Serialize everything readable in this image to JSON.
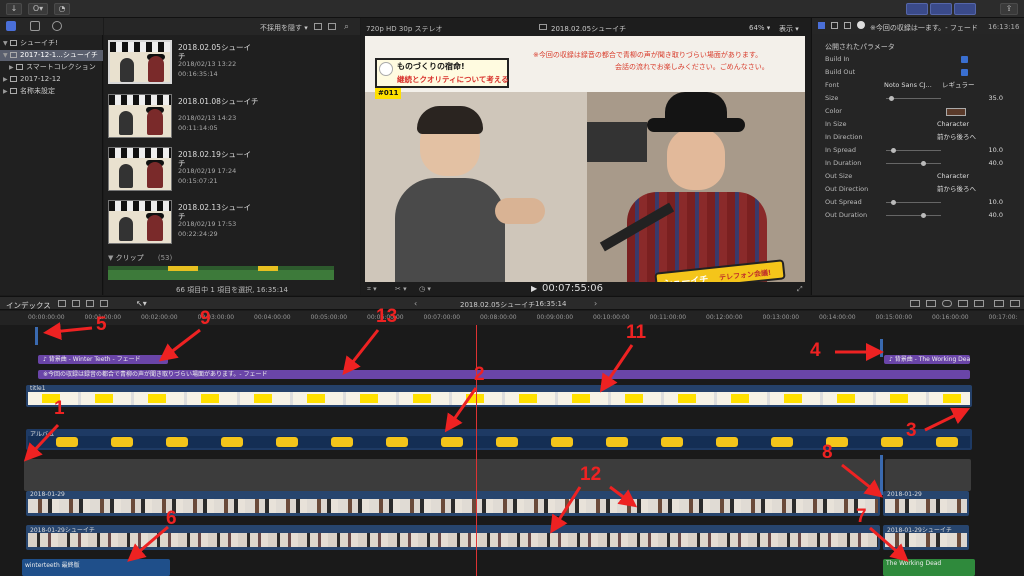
{
  "toolbar": {
    "import_glyph": "↓",
    "keyword_glyph": "O▾",
    "bg_task_glyph": "◔",
    "share_glyph": "⇪"
  },
  "library": {
    "items": [
      {
        "label": "シューイチ!",
        "expanded": true,
        "selected": false
      },
      {
        "label": "2017-12-1...シューイチ",
        "expanded": true,
        "selected": true
      },
      {
        "label": "スマートコレクション",
        "expanded": false,
        "selected": false
      },
      {
        "label": "2017-12-12",
        "expanded": false,
        "selected": false
      },
      {
        "label": "名称未設定",
        "expanded": false,
        "selected": false
      }
    ]
  },
  "browser": {
    "filter_label": "不採用を隠す ▾",
    "clips": [
      {
        "title": "2018.02.05シューイ",
        "title2": "チ",
        "date": "2018/02/13 13:22",
        "duration": "00:16:35:14"
      },
      {
        "title": "2018.01.08シューイチ",
        "title2": "",
        "date": "2018/02/13 14:23",
        "duration": "00:11:14:05"
      },
      {
        "title": "2018.02.19シューイ",
        "title2": "チ",
        "date": "2018/02/19 17:24",
        "duration": "00:15:07:21"
      },
      {
        "title": "2018.02.13シューイ",
        "title2": "チ",
        "date": "2018/02/19 17:53",
        "duration": "00:22:24:29"
      }
    ],
    "clips_section": "クリップ",
    "clips_count": "(53)",
    "status": "66 項目中 1 項目を選択, 16:35:14"
  },
  "viewer": {
    "format": "720p HD 30p ステレオ",
    "title": "2018.02.05シューイチ",
    "zoom": "64% ▾",
    "view": "表示 ▾",
    "timecode": "00:07:55:06",
    "overlay_title_line1": "ものづくりの宿命!",
    "overlay_title_line2": "継続とクオリティについて考える",
    "episode": "#011",
    "notice_line1": "※今回の収録は録音の都合で青柳の声が聞き取りづらい場面があります。",
    "notice_line2": "会話の流れでお楽しみください。ごめんなさい。",
    "badge_main": "シューイチ",
    "badge_sub": "テレフォン会議!"
  },
  "inspector": {
    "header": "※今回の収録は一ます。- フェード",
    "time": "16:13:16",
    "section": "公開されたパラメータ",
    "rows": [
      {
        "label": "Build In",
        "type": "check"
      },
      {
        "label": "Build Out",
        "type": "check"
      },
      {
        "label": "Font",
        "value": "Noto Sans CJ...",
        "value2": "レギュラー"
      },
      {
        "label": "Size",
        "type": "slider",
        "pos": 0.05,
        "num": "35.0"
      },
      {
        "label": "Color",
        "type": "color"
      },
      {
        "label": "In Size",
        "value": "Character"
      },
      {
        "label": "In Direction",
        "value": "前から後ろへ"
      },
      {
        "label": "In Spread",
        "type": "slider",
        "pos": 0.1,
        "num": "10.0"
      },
      {
        "label": "In Duration",
        "type": "slider",
        "pos": 0.7,
        "num": "40.0"
      },
      {
        "label": "Out Size",
        "value": "Character"
      },
      {
        "label": "Out Direction",
        "value": "前から後ろへ"
      },
      {
        "label": "Out Spread",
        "type": "slider",
        "pos": 0.1,
        "num": "10.0"
      },
      {
        "label": "Out Duration",
        "type": "slider",
        "pos": 0.7,
        "num": "40.0"
      }
    ]
  },
  "timeline": {
    "index_label": "インデックス",
    "project": "2018.02.05シューイチ",
    "duration": "16:35:14",
    "ruler": [
      "00:00:00:00",
      "00:01:00:00",
      "00:02:00:00",
      "00:03:00:00",
      "00:04:00:00",
      "00:05:00:00",
      "00:06:00:00",
      "00:07:00:00",
      "00:08:00:00",
      "00:09:00:00",
      "00:10:00:00",
      "00:11:00:00",
      "00:12:00:00",
      "00:13:00:00",
      "00:14:00:00",
      "00:15:00:00",
      "00:16:00:00",
      "00:17:00:"
    ],
    "music_intro": "♪ 背景曲 - Winter Teeth - フェード",
    "music_outro": "♪ 背景曲 - The Working Dead - フェード",
    "notice_bar": "※今回の収録は録音の都合で青柳の声が聞き取りづらい場面があります。- フェード",
    "title_track": "title1",
    "phone_track": "アルバム",
    "video1": "2018-01-29",
    "video1_end": "2018-01-29",
    "video2": "2018-01-29シューイチ",
    "video2_end": "2018-01-29シューイチ",
    "audio_intro": "winterteeth 最終版",
    "audio_outro": "The Working Dead"
  },
  "annotations": [
    "1",
    "2",
    "3",
    "4",
    "5",
    "6",
    "7",
    "8",
    "9",
    "11",
    "12",
    "13"
  ]
}
